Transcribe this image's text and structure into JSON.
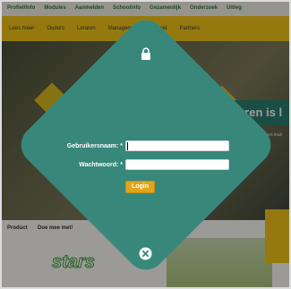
{
  "background": {
    "nav_items": [
      "Profiel/Info",
      "Modules",
      "Aanmelden",
      "Schoolinfo",
      "Gezamenlijk",
      "Onderzoek",
      "Uitleg"
    ],
    "subnav_items": [
      "Lees meer",
      "Ouders",
      "Leraren",
      "Management",
      "Beleid",
      "Partners"
    ],
    "banner_title": "Leren is l",
    "banner_text": "Leren moet niet alleen leuk zijn, maar ook...",
    "tabs": [
      "Product",
      "Doe mee met!"
    ],
    "stars_logo": "stars"
  },
  "modal": {
    "icons": {
      "top": "lock-icon",
      "bottom": "close-icon"
    },
    "username_label": "Gebruikersnaam: *",
    "username_value": "",
    "password_label": "Wachtwoord: *",
    "password_value": "",
    "login_label": "Login",
    "colors": {
      "diamond": "#38877b",
      "button": "#e0a51c"
    }
  }
}
